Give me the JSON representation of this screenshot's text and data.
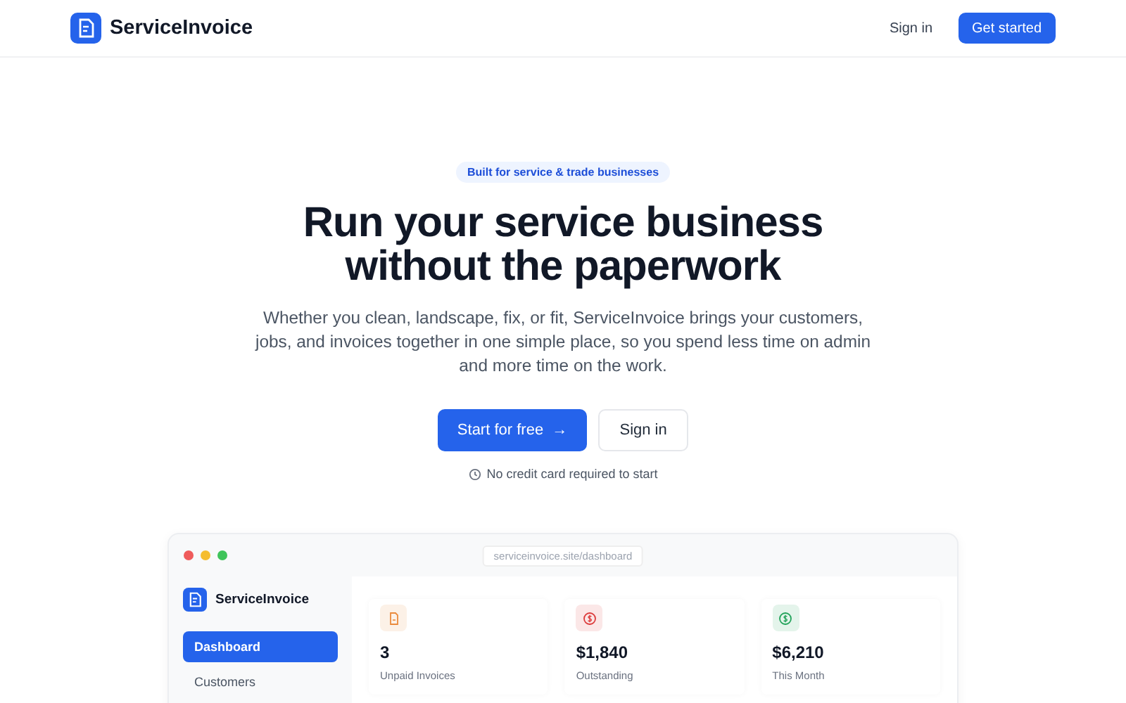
{
  "header": {
    "brand": "ServiceInvoice",
    "nav": [
      {
        "label": "Sign in",
        "kind": "link"
      },
      {
        "label": "Get started",
        "kind": "primary"
      }
    ]
  },
  "hero": {
    "badge": "Built for service & trade businesses",
    "title_lines": [
      "Run your service business",
      "without the paperwork"
    ],
    "description": "Whether you clean, landscape, fix, or fit, ServiceInvoice brings your customers, jobs, and invoices together in one simple place, so you spend less time on admin and more time on the work.",
    "buttons": [
      {
        "label": "Start for free",
        "kind": "primary",
        "arrow": "→"
      },
      {
        "label": "Sign in",
        "kind": "secondary"
      }
    ],
    "note": "No credit card required to start"
  },
  "preview": {
    "url": "serviceinvoice.site/dashboard",
    "brand": "ServiceInvoice",
    "sidebar": {
      "items": [
        {
          "label": "Dashboard",
          "selected": true
        },
        {
          "label": "Customers",
          "selected": false
        }
      ]
    },
    "stats": [
      {
        "value": "3",
        "label": "Unpaid Invoices",
        "kind": "document",
        "color": "#ea8a3c"
      },
      {
        "value": "$1,840",
        "label": "Outstanding",
        "kind": "dollar",
        "color": "#dc3b3b"
      },
      {
        "value": "$6,210",
        "label": "This Month",
        "kind": "dollar",
        "color": "#22a35a"
      }
    ]
  }
}
